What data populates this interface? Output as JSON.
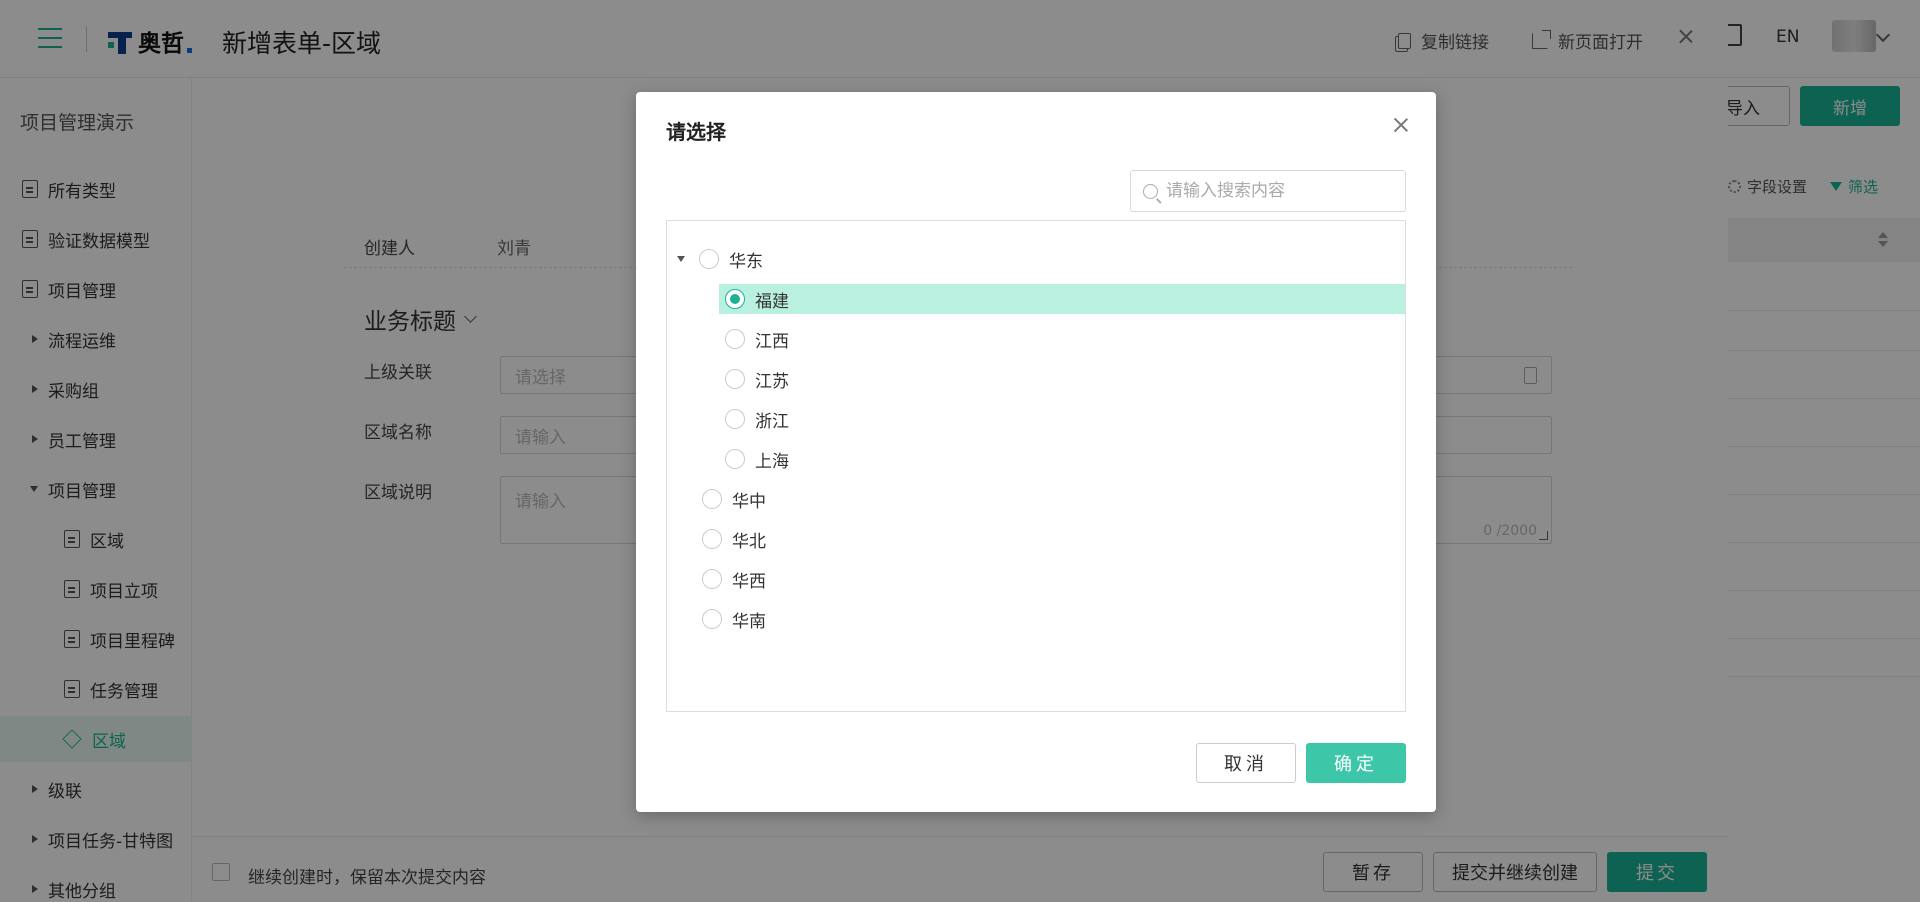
{
  "app": {
    "logo_text": "奥哲",
    "lang": "EN"
  },
  "sidebar": {
    "title": "项目管理演示",
    "items": [
      {
        "label": "所有类型"
      },
      {
        "label": "验证数据模型"
      },
      {
        "label": "项目管理"
      },
      {
        "label": "流程运维"
      },
      {
        "label": "采购组"
      },
      {
        "label": "员工管理"
      },
      {
        "label": "项目管理"
      },
      {
        "label": "区域"
      },
      {
        "label": "项目立项"
      },
      {
        "label": "项目里程碑"
      },
      {
        "label": "任务管理"
      },
      {
        "label": "区域"
      },
      {
        "label": "级联"
      },
      {
        "label": "项目任务-甘特图"
      },
      {
        "label": "其他分组"
      }
    ]
  },
  "main": {
    "import_label": "导入",
    "new_label": "新增",
    "fields_settings_label": "字段设置",
    "filter_label": "筛选"
  },
  "drawer": {
    "title": "新增表单-区域",
    "copy_link_label": "复制链接",
    "open_new_page_label": "新页面打开",
    "creator_label": "创建人",
    "creator_value": "刘青",
    "section_title": "业务标题",
    "fields": {
      "parent": {
        "label": "上级关联",
        "placeholder": "请选择"
      },
      "name": {
        "label": "区域名称",
        "placeholder": "请输入"
      },
      "desc": {
        "label": "区域说明",
        "placeholder": "请输入",
        "counter": "0 /2000"
      }
    },
    "footer": {
      "keep_content_label": "继续创建时，保留本次提交内容",
      "save_draft_label": "暂存",
      "submit_continue_label": "提交并继续创建",
      "submit_label": "提交"
    }
  },
  "modal": {
    "title": "请选择",
    "search_placeholder": "请输入搜索内容",
    "tree": [
      {
        "label": "华东",
        "expanded": true,
        "children": [
          {
            "label": "福建",
            "selected": true
          },
          {
            "label": "江西"
          },
          {
            "label": "江苏"
          },
          {
            "label": "浙江"
          },
          {
            "label": "上海"
          }
        ]
      },
      {
        "label": "华中"
      },
      {
        "label": "华北"
      },
      {
        "label": "华西"
      },
      {
        "label": "华南"
      }
    ],
    "cancel_label": "取消",
    "ok_label": "确定"
  },
  "colors": {
    "accent": "#1bb394",
    "selected_row": "#b9f0df",
    "ok_button": "#3ec6a8"
  }
}
